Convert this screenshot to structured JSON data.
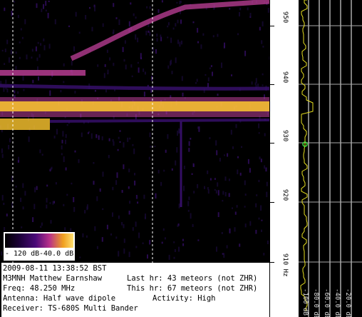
{
  "colorbar": {
    "min_label": "- 120 dB",
    "max_label": "-40.0 dB"
  },
  "info": {
    "line1": "2009-08-11 13:38:52 BST",
    "line2_left": "M3MNH Matthew Earnshaw",
    "line2_right": "Last hr: 43 meteors (not ZHR)",
    "line3_left": "Freq: 48.250 MHz",
    "line3_right": "This hr: 67 meteors (not ZHR)",
    "line4_left": "Antenna: Half wave dipole",
    "line4_right": "Activity: High",
    "line5": "Receiver: TS-680S Multi Bander"
  },
  "axis": {
    "labels": [
      "950",
      "940",
      "930",
      "920",
      "910 Hz"
    ]
  },
  "activity": {
    "db_labels": [
      "-100 dB",
      "-80.0 dB",
      "-60.0 dB",
      "-40.0 dB",
      "-20.0 dB"
    ]
  },
  "colors": {
    "signal_hot": "#ffc830",
    "signal_mid": "#c0409a",
    "signal_low": "#3a1070",
    "trace": "#e8e020",
    "marker": "#40e040"
  }
}
